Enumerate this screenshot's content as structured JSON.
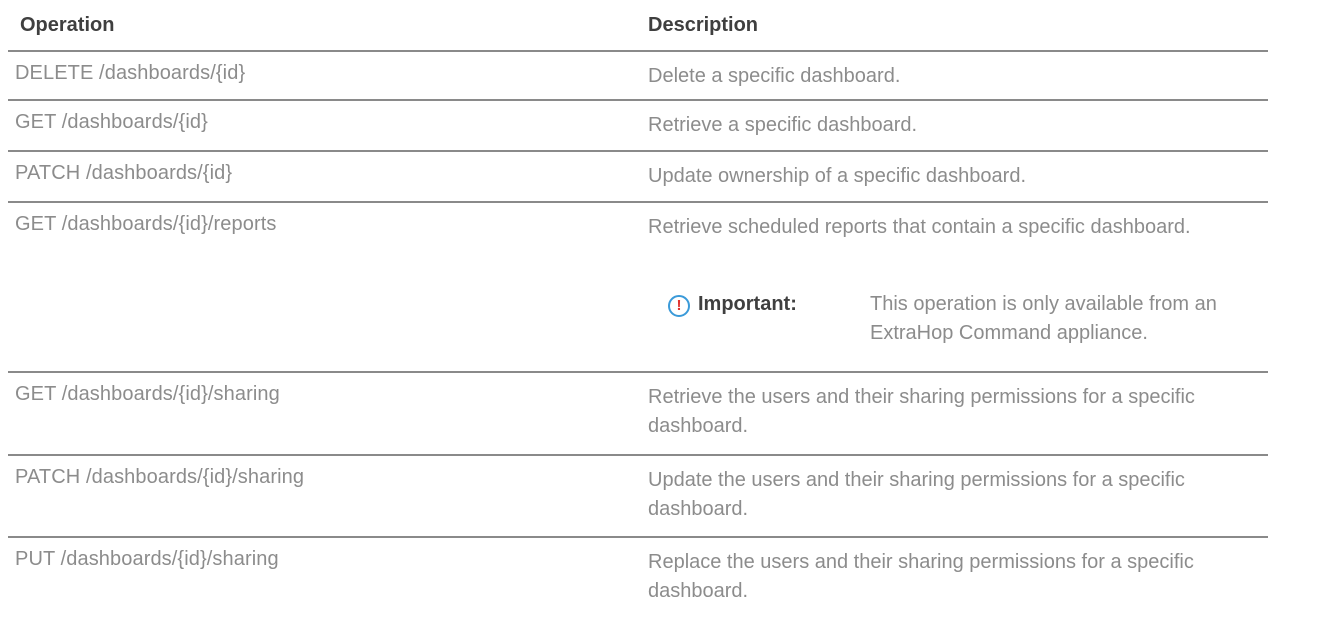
{
  "table": {
    "headers": {
      "operation": "Operation",
      "description": "Description"
    },
    "rows": [
      {
        "operation": "DELETE /dashboards/{id}",
        "description": "Delete a specific dashboard."
      },
      {
        "operation": "GET /dashboards/{id}",
        "description": "Retrieve a specific dashboard."
      },
      {
        "operation": "PATCH /dashboards/{id}",
        "description": "Update ownership of a specific dashboard."
      },
      {
        "operation": "GET /dashboards/{id}/reports",
        "description": "Retrieve scheduled reports that contain a specific dashboard.",
        "note": {
          "icon": "important-icon",
          "glyph": "!",
          "label": "Important:",
          "text": "This operation is only available from an ExtraHop Command appliance."
        }
      },
      {
        "operation": "GET /dashboards/{id}/sharing",
        "description": "Retrieve the users and their sharing permissions for a specific dashboard."
      },
      {
        "operation": "PATCH /dashboards/{id}/sharing",
        "description": "Update the users and their sharing permissions for a specific dashboard."
      },
      {
        "operation": "PUT /dashboards/{id}/sharing",
        "description": "Replace the users and their sharing permissions for a specific dashboard."
      }
    ]
  },
  "colors": {
    "text_muted": "#8c8c8c",
    "header_text": "#3f3f3f",
    "rule": "#8a8a8a",
    "note_icon_ring": "#3a9ad9",
    "note_icon_glyph": "#e0322f"
  }
}
